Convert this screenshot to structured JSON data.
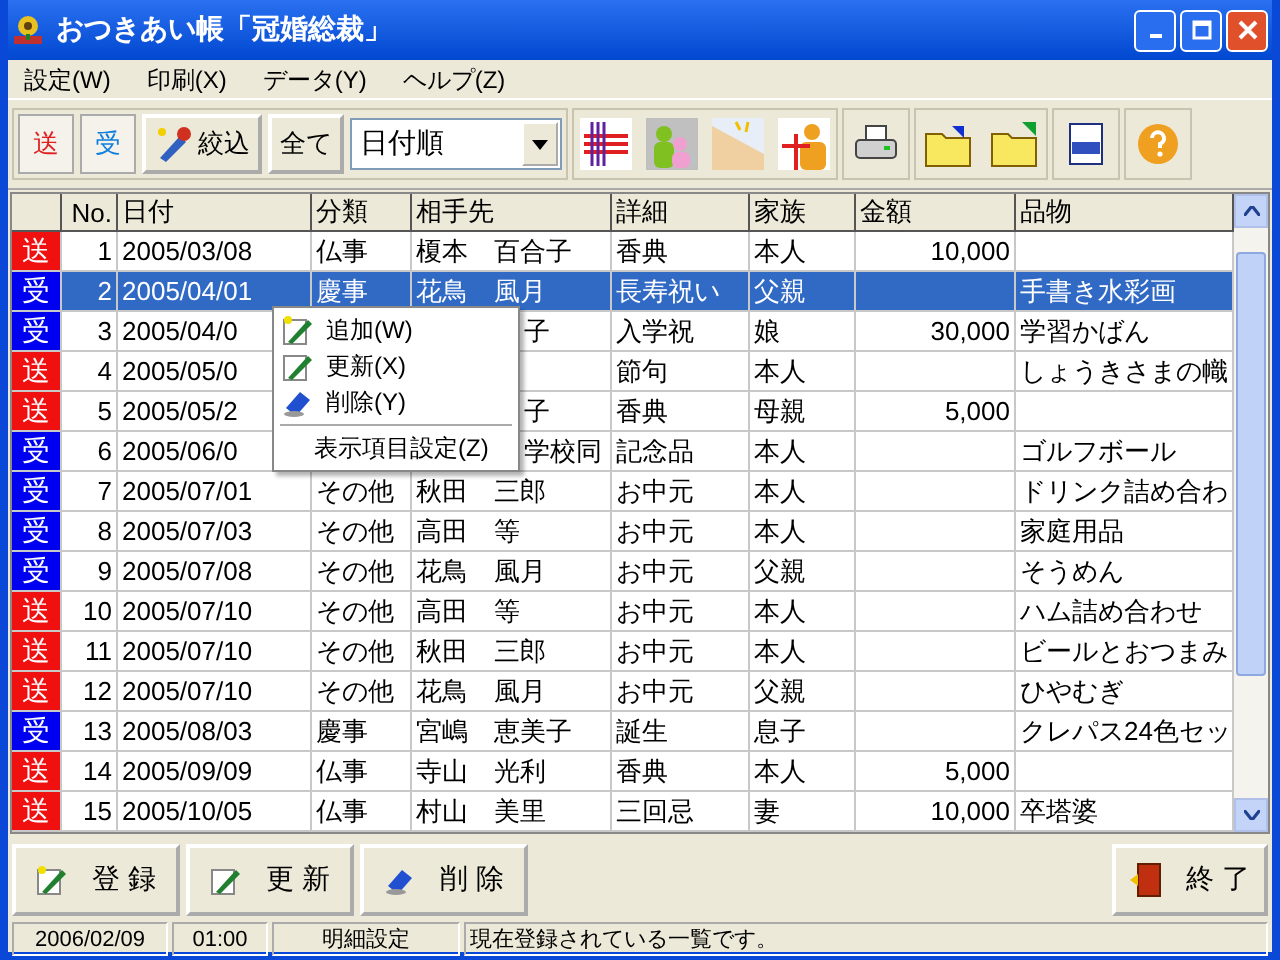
{
  "window": {
    "title": "おつきあい帳「冠婚総裁」"
  },
  "menu": [
    "設定(W)",
    "印刷(X)",
    "データ(Y)",
    "ヘルプ(Z)"
  ],
  "toolbar": {
    "send_label": "送",
    "receive_label": "受",
    "filter_label": "絞込",
    "all_label": "全て",
    "sort": {
      "value": "日付順"
    }
  },
  "table": {
    "columns": [
      "No.",
      "日付",
      "分類",
      "相手先",
      "詳細",
      "家族",
      "金額",
      "品物"
    ],
    "rows": [
      {
        "kind": "send",
        "flag": "送",
        "cells": [
          "1",
          "2005/03/08",
          "仏事",
          "榎本　百合子",
          "香典",
          "本人",
          "10,000",
          ""
        ],
        "selected": false
      },
      {
        "kind": "receive",
        "flag": "受",
        "cells": [
          "2",
          "2005/04/01",
          "慶事",
          "花鳥　風月",
          "長寿祝い",
          "父親",
          "",
          "手書き水彩画"
        ],
        "selected": true
      },
      {
        "kind": "receive",
        "flag": "受",
        "cells": [
          "3",
          "2005/04/0",
          "",
          "子",
          "入学祝",
          "娘",
          "30,000",
          "学習かばん"
        ],
        "selected": false
      },
      {
        "kind": "send",
        "flag": "送",
        "cells": [
          "4",
          "2005/05/0",
          "",
          "",
          "節句",
          "本人",
          "",
          "しょうきさまの幟"
        ],
        "selected": false
      },
      {
        "kind": "send",
        "flag": "送",
        "cells": [
          "5",
          "2005/05/2",
          "",
          "子",
          "香典",
          "母親",
          "5,000",
          ""
        ],
        "selected": false
      },
      {
        "kind": "receive",
        "flag": "受",
        "cells": [
          "6",
          "2005/06/0",
          "",
          "学校同",
          "記念品",
          "本人",
          "",
          "ゴルフボール"
        ],
        "selected": false
      },
      {
        "kind": "receive",
        "flag": "受",
        "cells": [
          "7",
          "2005/07/01",
          "その他",
          "秋田　三郎",
          "お中元",
          "本人",
          "",
          "ドリンク詰め合わ"
        ],
        "selected": false
      },
      {
        "kind": "receive",
        "flag": "受",
        "cells": [
          "8",
          "2005/07/03",
          "その他",
          "高田　等",
          "お中元",
          "本人",
          "",
          "家庭用品"
        ],
        "selected": false
      },
      {
        "kind": "receive",
        "flag": "受",
        "cells": [
          "9",
          "2005/07/08",
          "その他",
          "花鳥　風月",
          "お中元",
          "父親",
          "",
          "そうめん"
        ],
        "selected": false
      },
      {
        "kind": "send",
        "flag": "送",
        "cells": [
          "10",
          "2005/07/10",
          "その他",
          "高田　等",
          "お中元",
          "本人",
          "",
          "ハム詰め合わせ"
        ],
        "selected": false
      },
      {
        "kind": "send",
        "flag": "送",
        "cells": [
          "11",
          "2005/07/10",
          "その他",
          "秋田　三郎",
          "お中元",
          "本人",
          "",
          "ビールとおつまみ"
        ],
        "selected": false
      },
      {
        "kind": "send",
        "flag": "送",
        "cells": [
          "12",
          "2005/07/10",
          "その他",
          "花鳥　風月",
          "お中元",
          "父親",
          "",
          "ひやむぎ"
        ],
        "selected": false
      },
      {
        "kind": "receive",
        "flag": "受",
        "cells": [
          "13",
          "2005/08/03",
          "慶事",
          "宮嶋　恵美子",
          "誕生",
          "息子",
          "",
          "クレパス24色セッ"
        ],
        "selected": false
      },
      {
        "kind": "send",
        "flag": "送",
        "cells": [
          "14",
          "2005/09/09",
          "仏事",
          "寺山　光利",
          "香典",
          "本人",
          "5,000",
          ""
        ],
        "selected": false
      },
      {
        "kind": "send",
        "flag": "送",
        "cells": [
          "15",
          "2005/10/05",
          "仏事",
          "村山　美里",
          "三回忌",
          "妻",
          "10,000",
          "卒塔婆"
        ],
        "selected": false
      }
    ]
  },
  "context_menu": [
    {
      "kind": "item",
      "label": "追加(W)"
    },
    {
      "kind": "item",
      "label": "更新(X)"
    },
    {
      "kind": "item",
      "label": "削除(Y)"
    },
    {
      "kind": "separator"
    },
    {
      "kind": "item",
      "label": "表示項目設定(Z)"
    }
  ],
  "buttons": [
    {
      "label": "登 録"
    },
    {
      "label": "更 新"
    },
    {
      "label": "削 除"
    }
  ],
  "exit_button": {
    "label": "終 了"
  },
  "status_bar": [
    "2006/02/09",
    "01:00",
    "明細設定",
    "現在登録されている一覧です。"
  ]
}
